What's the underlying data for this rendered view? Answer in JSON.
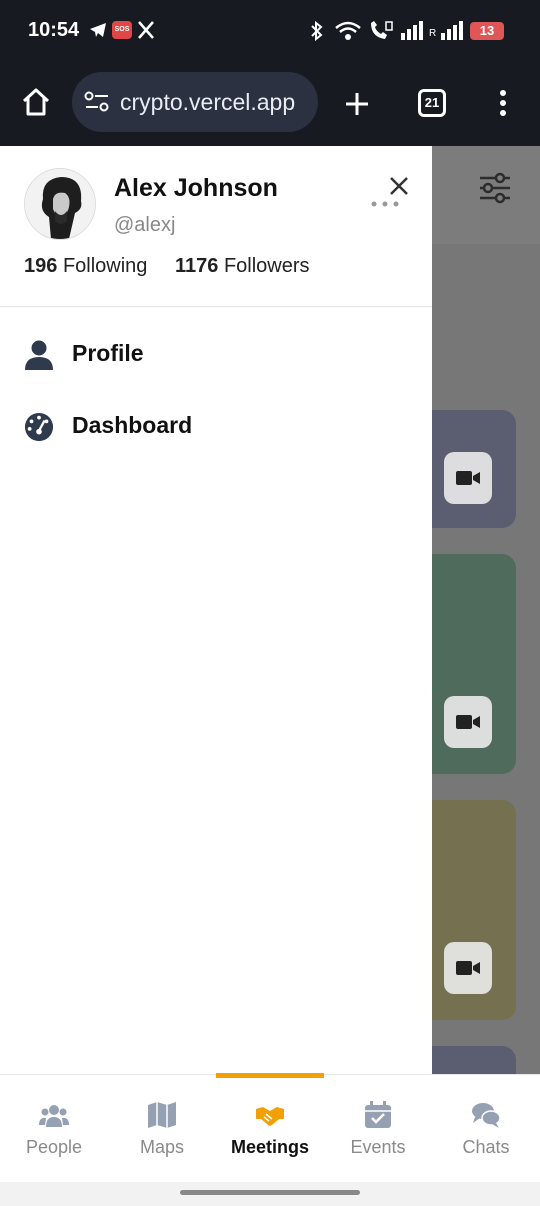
{
  "status_bar": {
    "time": "10:54",
    "battery": "13",
    "sos_badge": "SOS",
    "signal_label": "R"
  },
  "browser": {
    "url": "crypto.vercel.app",
    "tab_count": "21"
  },
  "drawer": {
    "user": {
      "name": "Alex Johnson",
      "handle": "@alexj",
      "following_count": "196",
      "following_label": "Following",
      "followers_count": "1176",
      "followers_label": "Followers"
    },
    "menu": [
      {
        "label": "Profile",
        "icon": "person-icon"
      },
      {
        "label": "Dashboard",
        "icon": "gauge-icon"
      }
    ]
  },
  "bottom_nav": {
    "items": [
      {
        "label": "People",
        "icon": "people-icon"
      },
      {
        "label": "Maps",
        "icon": "map-icon"
      },
      {
        "label": "Meetings",
        "icon": "handshake-icon"
      },
      {
        "label": "Events",
        "icon": "calendar-check-icon"
      },
      {
        "label": "Chats",
        "icon": "chat-icon"
      }
    ],
    "active_index": 2
  },
  "colors": {
    "accent": "#f2a007",
    "status_bar": "#171a21",
    "card_blue": "#b3b7c9",
    "card_green": "#7fa68e",
    "card_yellow": "#b3a97e"
  }
}
